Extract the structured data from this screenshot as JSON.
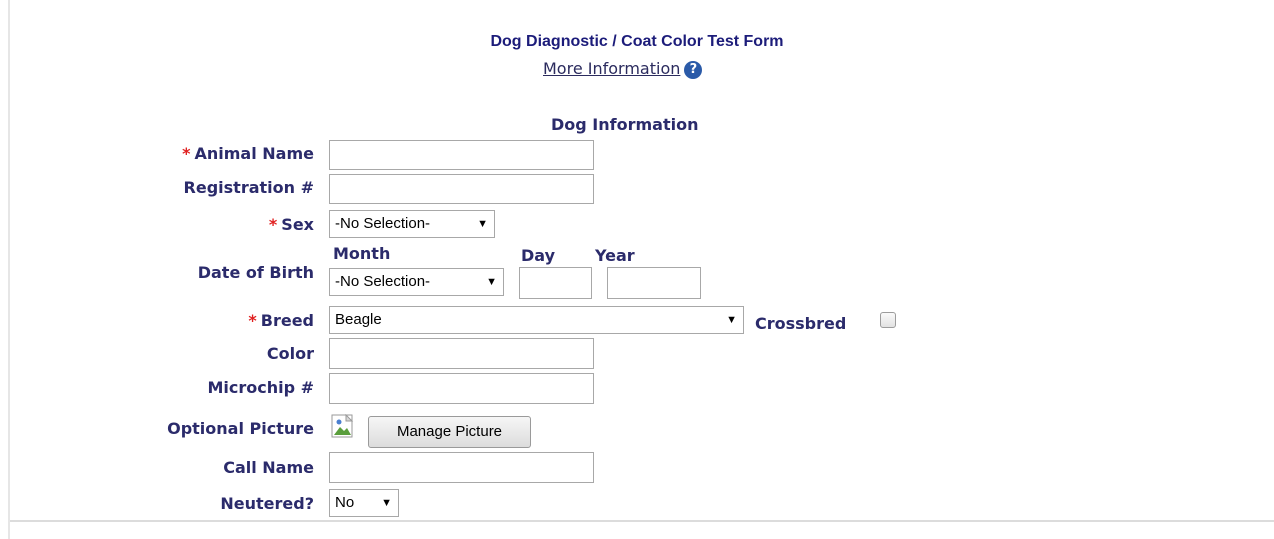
{
  "header": {
    "title": "Dog Diagnostic / Coat Color Test Form",
    "more_info": "More Information",
    "help_glyph": "?"
  },
  "section": {
    "title": "Dog Information"
  },
  "required_marker": "*",
  "fields": {
    "animal_name": {
      "label": "Animal Name",
      "value": ""
    },
    "registration": {
      "label": "Registration #",
      "value": ""
    },
    "sex": {
      "label": "Sex",
      "selected": "-No Selection-"
    },
    "dob": {
      "label": "Date of Birth",
      "month_label": "Month",
      "day_label": "Day",
      "year_label": "Year",
      "month_selected": "-No Selection-",
      "day_value": "",
      "year_value": ""
    },
    "breed": {
      "label": "Breed",
      "selected": "Beagle",
      "crossbred_label": "Crossbred"
    },
    "color": {
      "label": "Color",
      "value": ""
    },
    "microchip": {
      "label": "Microchip #",
      "value": ""
    },
    "picture": {
      "label": "Optional Picture",
      "button": "Manage Picture"
    },
    "call_name": {
      "label": "Call Name",
      "value": ""
    },
    "neutered": {
      "label": "Neutered?",
      "selected": "No"
    }
  },
  "caret_glyph": "▼",
  "colors": {
    "label": "#2b2b6b",
    "title": "#1c1c7a",
    "required": "#e02020",
    "help_icon": "#2a5aa8"
  }
}
